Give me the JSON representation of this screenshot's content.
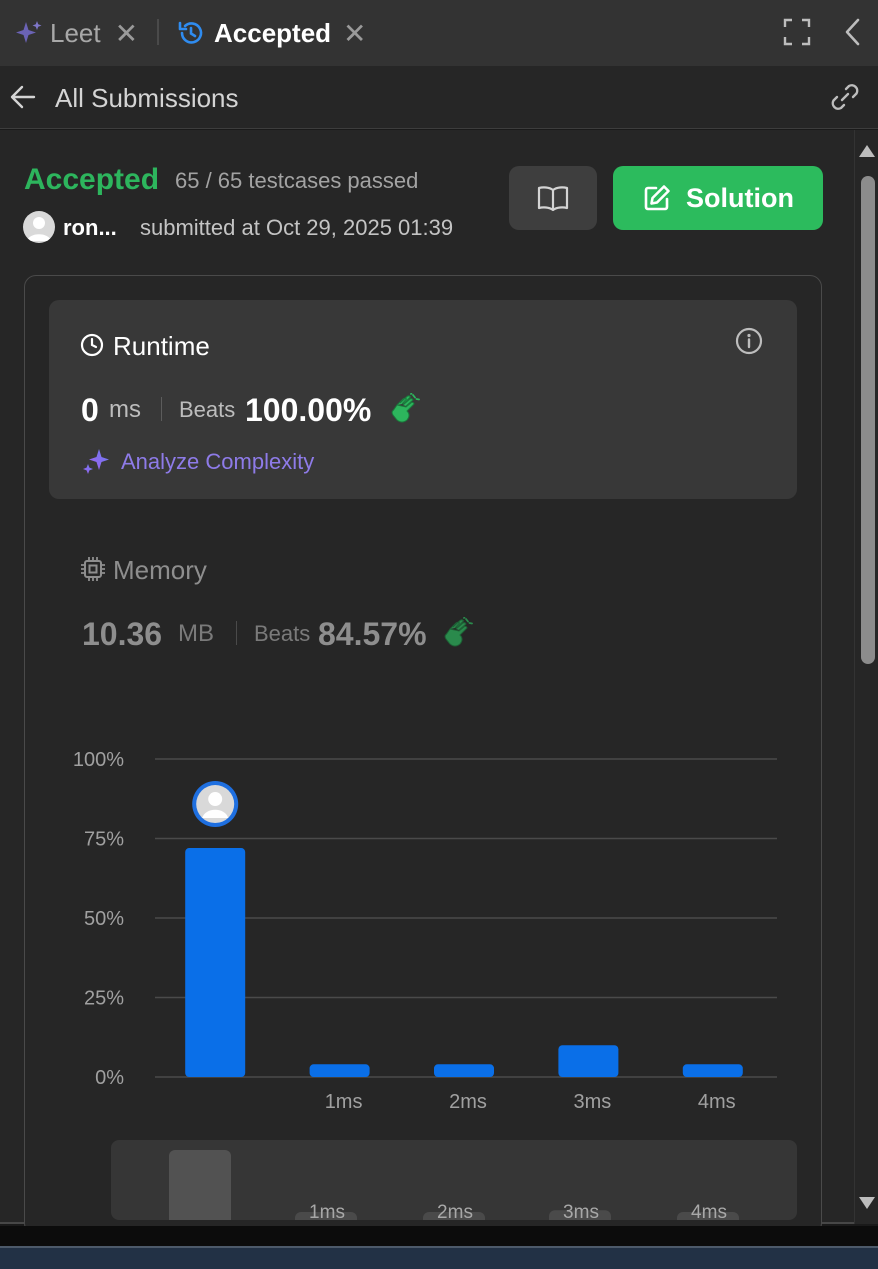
{
  "tabs": [
    {
      "label": "Leet"
    },
    {
      "label": "Accepted"
    }
  ],
  "subheader": {
    "back_label": "All Submissions"
  },
  "submission": {
    "status": "Accepted",
    "testcases": "65 / 65 testcases passed",
    "username": "ron...",
    "submitted": "submitted at Oct 29, 2025 01:39",
    "solution_label": "Solution"
  },
  "runtime": {
    "title": "Runtime",
    "value": "0",
    "unit": "ms",
    "beats_label": "Beats",
    "percent": "100.00%",
    "analyze_label": "Analyze Complexity"
  },
  "memory": {
    "title": "Memory",
    "value": "10.36",
    "unit": "MB",
    "beats_label": "Beats",
    "percent": "84.57%"
  },
  "colors": {
    "accent_green": "#2cbb5d",
    "bar_blue": "#0a6fe8",
    "purple": "#8e7be8"
  },
  "chart_data": {
    "type": "bar",
    "categories": [
      "",
      "1ms",
      "2ms",
      "3ms",
      "4ms"
    ],
    "values": [
      72,
      4,
      4,
      10,
      4
    ],
    "ytick_labels": [
      "0%",
      "25%",
      "50%",
      "75%",
      "100%"
    ],
    "yticks": [
      0,
      25,
      50,
      75,
      100
    ],
    "ylim": [
      0,
      100
    ],
    "grid": true,
    "highlight_index": 0,
    "mini_categories": [
      "",
      "1ms",
      "2ms",
      "3ms",
      "4ms"
    ]
  }
}
